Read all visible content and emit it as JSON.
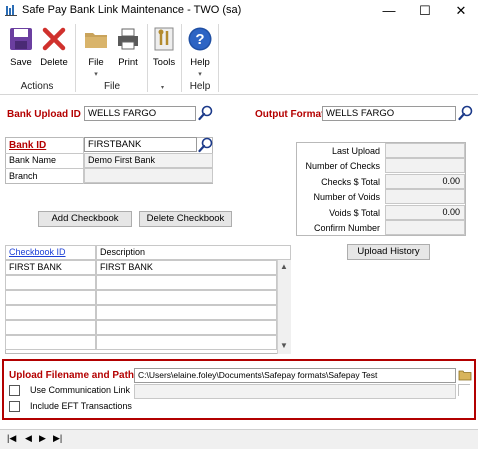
{
  "window": {
    "title": "Safe Pay Bank Link Maintenance  -  TWO (sa)",
    "minimize": "—",
    "maximize": "☐",
    "close": "✕"
  },
  "ribbon": {
    "actions": {
      "save": "Save",
      "delete": "Delete",
      "group": "Actions"
    },
    "file": {
      "file": "File",
      "print": "Print",
      "group": "File"
    },
    "tools": {
      "tools": "Tools",
      "arrow": "▾"
    },
    "help": {
      "help": "Help",
      "group": "Help"
    }
  },
  "form": {
    "bank_upload_id_label": "Bank Upload ID",
    "bank_upload_id_value": "WELLS FARGO",
    "output_format_label": "Output Format",
    "output_format_value": "WELLS FARGO",
    "bank_id_label": "Bank ID",
    "bank_id_value": "FIRSTBANK",
    "bank_name_label": "Bank Name",
    "bank_name_value": "Demo First Bank",
    "branch_label": "Branch",
    "branch_value": "",
    "add_checkbook": "Add Checkbook",
    "delete_checkbook": "Delete Checkbook"
  },
  "stats": {
    "last_upload": "Last Upload",
    "number_of_checks": "Number of Checks",
    "checks_total": "Checks $ Total",
    "checks_total_value": "0.00",
    "number_of_voids": "Number of Voids",
    "voids_total": "Voids $ Total",
    "voids_total_value": "0.00",
    "confirm_number": "Confirm Number",
    "upload_history": "Upload History"
  },
  "grid": {
    "col_checkbook": "Checkbook ID",
    "col_description": "Description",
    "rows": [
      {
        "checkbook": "FIRST BANK",
        "description": "FIRST BANK"
      }
    ]
  },
  "upload": {
    "label": "Upload Filename and Path",
    "path": "C:\\Users\\elaine.foley\\Documents\\Safepay formats\\Safepay Test",
    "use_comm_link": "Use Communication Link",
    "include_eft": "Include EFT Transactions"
  },
  "nav": {
    "first": "|◀",
    "prev": "◀",
    "next": "▶",
    "last": "▶|"
  }
}
